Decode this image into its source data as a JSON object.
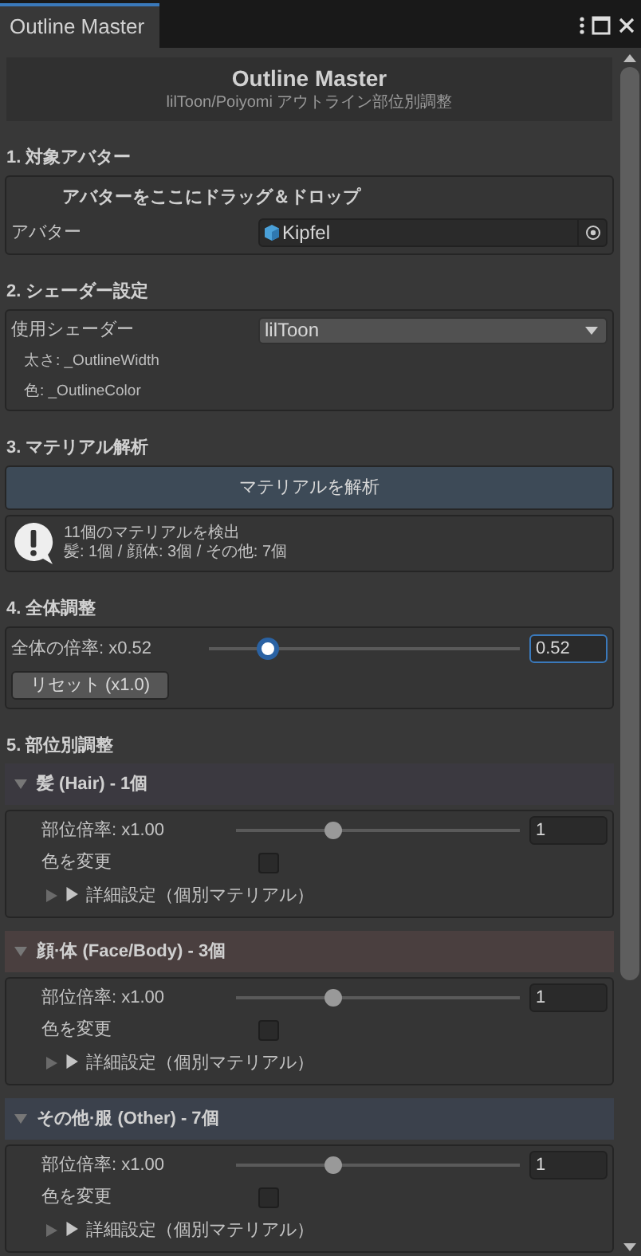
{
  "window": {
    "tab": "Outline Master"
  },
  "header": {
    "title": "Outline Master",
    "subtitle": "lilToon/Poiyomi アウトライン部位別調整"
  },
  "avatar_section": {
    "heading": "1. 対象アバター",
    "drop_label": "アバターをここにドラッグ＆ドロップ",
    "field_label": "アバター",
    "value": "Kipfel"
  },
  "shader_section": {
    "heading": "2. シェーダー設定",
    "field_label": "使用シェーダー",
    "value": "lilToon",
    "info": [
      "太さ: _OutlineWidth",
      "色: _OutlineColor"
    ]
  },
  "material_section": {
    "heading": "3. マテリアル解析",
    "button": "マテリアルを解析",
    "message": [
      "11個のマテリアルを検出",
      "髪: 1個 / 顔体: 3個 / その他: 7個"
    ]
  },
  "global_section": {
    "heading": "4. 全体調整",
    "label": "全体の倍率: x0.52",
    "level": 0.19,
    "value": "0.52",
    "reset": "リセット (x1.0)"
  },
  "parts_section": {
    "heading": "5. 部位別調整",
    "parts": [
      {
        "title": "髪 (Hair) - 1個",
        "expanded": true,
        "color": "#3b3940",
        "label": "部位倍率: x1.00",
        "level": 0.34,
        "value": "1",
        "color_label": "色を変更",
        "checked": false,
        "details": "▶ 詳細設定（個別マテリアル）",
        "details_expanded": false
      },
      {
        "title": "顔·体 (Face/Body) - 3個",
        "expanded": true,
        "color": "#4a3f3f",
        "label": "部位倍率: x1.00",
        "level": 0.34,
        "value": "1",
        "color_label": "色を変更",
        "checked": false,
        "details": "▶ 詳細設定（個別マテリアル）",
        "details_expanded": false
      },
      {
        "title": "その他·服 (Other) - 7個",
        "expanded": true,
        "color": "#3b414c",
        "label": "部位倍率: x1.00",
        "level": 0.34,
        "value": "1",
        "color_label": "色を変更",
        "checked": false,
        "details": "▶ 詳細設定（個別マテリアル）",
        "details_expanded": false
      }
    ]
  }
}
